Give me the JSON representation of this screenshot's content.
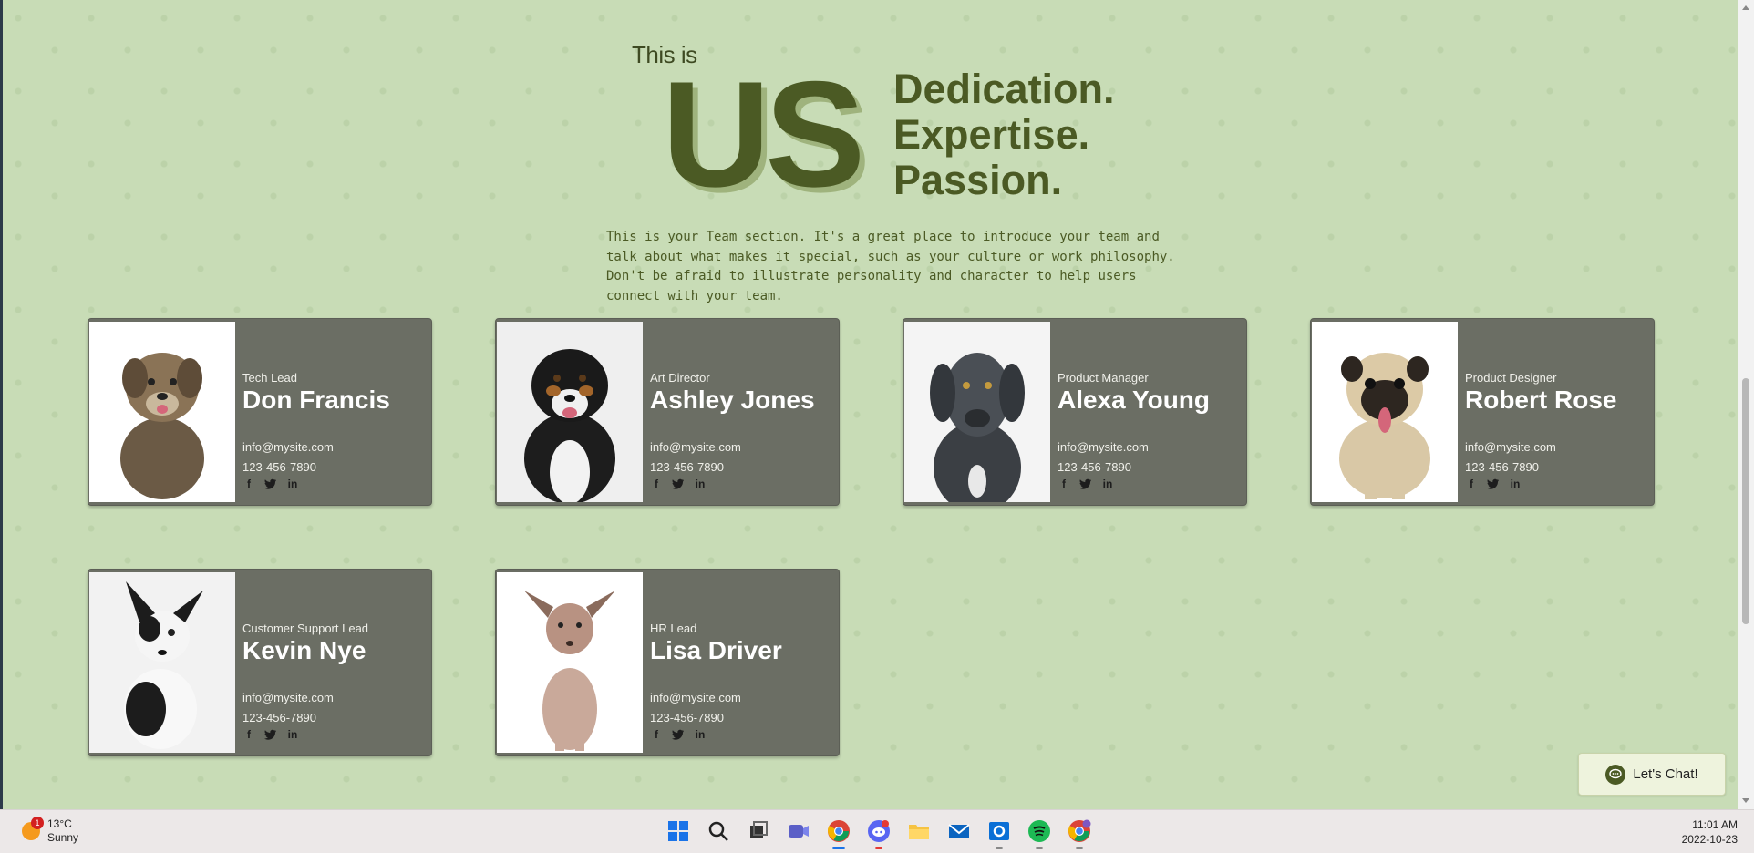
{
  "hero": {
    "small_text": "This is",
    "big_text": "US",
    "lines": [
      "Dedication.",
      "Expertise.",
      "Passion."
    ]
  },
  "intro": "This is your Team section. It's a great place to introduce your team and talk about what makes it special, such as your culture or work philosophy. Don't be afraid to illustrate personality and character to help users connect with your team.",
  "team": [
    {
      "role": "Tech Lead",
      "name": "Don Francis",
      "email": "info@mysite.com",
      "phone": "123-456-7890"
    },
    {
      "role": "Art Director",
      "name": "Ashley Jones",
      "email": "info@mysite.com",
      "phone": "123-456-7890"
    },
    {
      "role": "Product Manager",
      "name": "Alexa Young",
      "email": "info@mysite.com",
      "phone": "123-456-7890"
    },
    {
      "role": "Product Designer",
      "name": "Robert Rose",
      "email": "info@mysite.com",
      "phone": "123-456-7890"
    },
    {
      "role": "Customer Support Lead",
      "name": "Kevin Nye",
      "email": "info@mysite.com",
      "phone": "123-456-7890"
    },
    {
      "role": "HR Lead",
      "name": "Lisa Driver",
      "email": "info@mysite.com",
      "phone": "123-456-7890"
    }
  ],
  "social_icons": [
    "facebook-icon",
    "twitter-icon",
    "linkedin-icon"
  ],
  "chat": {
    "label": "Let's Chat!"
  },
  "taskbar": {
    "weather_temp": "13°C",
    "weather_desc": "Sunny",
    "weather_badge": "1",
    "time": "11:01 AM",
    "date": "2022-10-23",
    "apps": [
      "windows-start-icon",
      "search-icon",
      "task-view-icon",
      "teams-icon",
      "chrome-icon",
      "discord-icon",
      "file-explorer-icon",
      "mail-icon",
      "outlook-icon",
      "spotify-icon",
      "chrome-profile-icon"
    ]
  },
  "colors": {
    "background": "#c8dcb6",
    "accent": "#4b5a24",
    "card": "#6b6e64"
  }
}
